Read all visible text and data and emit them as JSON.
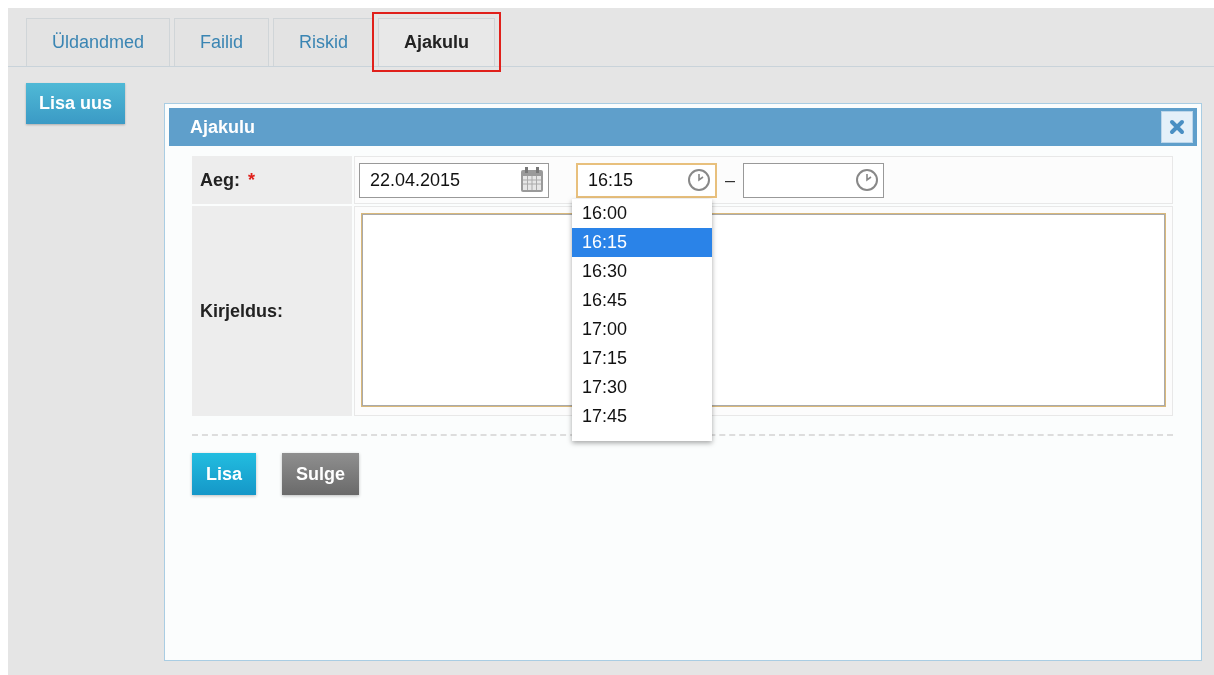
{
  "tabs": [
    {
      "label": "Üldandmed",
      "selected": false
    },
    {
      "label": "Failid",
      "selected": false
    },
    {
      "label": "Riskid",
      "selected": false
    },
    {
      "label": "Ajakulu",
      "selected": true
    }
  ],
  "add_new_button": "Lisa uus",
  "dialog": {
    "title": "Ajakulu",
    "date_row": {
      "label": "Aeg:",
      "required_mark": "*",
      "date": "22.04.2015",
      "start_time": "16:15",
      "separator": "–"
    },
    "description_row": {
      "label": "Kirjeldus:"
    },
    "time_options": [
      {
        "label": "16:00",
        "selected": false
      },
      {
        "label": "16:15",
        "selected": true
      },
      {
        "label": "16:30",
        "selected": false
      },
      {
        "label": "16:45",
        "selected": false
      },
      {
        "label": "17:00",
        "selected": false
      },
      {
        "label": "17:15",
        "selected": false
      },
      {
        "label": "17:30",
        "selected": false
      },
      {
        "label": "17:45",
        "selected": false
      }
    ],
    "buttons": [
      {
        "label": "Lisa",
        "kind": "primary"
      },
      {
        "label": "Sulge",
        "kind": "secondary"
      }
    ]
  }
}
